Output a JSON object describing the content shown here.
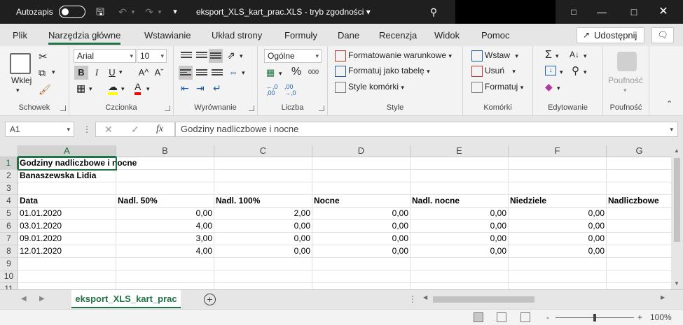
{
  "titlebar": {
    "autosave_label": "Autozapis",
    "autosave_state": "off",
    "doc_title": "eksport_XLS_kart_prac.XLS  -  tryb zgodności  ▾"
  },
  "tabs": [
    "Plik",
    "Narzędzia główne",
    "Wstawianie",
    "Układ strony",
    "Formuły",
    "Dane",
    "Recenzja",
    "Widok",
    "Pomoc"
  ],
  "active_tab": "Narzędzia główne",
  "share_label": "Udostępnij",
  "ribbon": {
    "clipboard": {
      "label": "Schowek",
      "paste": "Wklej"
    },
    "font": {
      "label": "Czcionka",
      "name": "Arial",
      "size": "10",
      "bold": "B",
      "italic": "I",
      "underline": "U",
      "grow": "A^",
      "shrink": "Aˇ"
    },
    "alignment": {
      "label": "Wyrównanie"
    },
    "number": {
      "label": "Liczba",
      "format": "Ogólne",
      "percent": "%",
      "thousands": "000"
    },
    "styles": {
      "label": "Style",
      "conditional": "Formatowanie warunkowe",
      "as_table": "Formatuj jako tabelę",
      "cell_styles": "Style komórki"
    },
    "cells": {
      "label": "Komórki",
      "insert": "Wstaw",
      "delete": "Usuń",
      "format": "Formatuj"
    },
    "editing": {
      "label": "Edytowanie"
    },
    "sensitivity": {
      "label": "Poufność",
      "button": "Poufność"
    }
  },
  "formula_bar": {
    "name_box": "A1",
    "fx": "fx",
    "content": "Godziny nadliczbowe i nocne"
  },
  "columns": [
    "A",
    "B",
    "C",
    "D",
    "E",
    "F",
    "G"
  ],
  "rows": [
    {
      "n": "1",
      "cells": [
        "Godziny nadliczbowe i nocne",
        "",
        "",
        "",
        "",
        "",
        ""
      ]
    },
    {
      "n": "2",
      "cells": [
        "Banaszewska Lidia",
        "",
        "",
        "",
        "",
        "",
        ""
      ]
    },
    {
      "n": "3",
      "cells": [
        "",
        "",
        "",
        "",
        "",
        "",
        ""
      ]
    },
    {
      "n": "4",
      "cells": [
        "Data",
        "Nadl. 50%",
        "Nadl. 100%",
        "Nocne",
        "Nadl. nocne",
        "Niedziele",
        "Nadliczbowe"
      ]
    },
    {
      "n": "5",
      "cells": [
        "01.01.2020",
        "0,00",
        "2,00",
        "0,00",
        "0,00",
        "0,00",
        ""
      ]
    },
    {
      "n": "6",
      "cells": [
        "03.01.2020",
        "4,00",
        "0,00",
        "0,00",
        "0,00",
        "0,00",
        ""
      ]
    },
    {
      "n": "7",
      "cells": [
        "09.01.2020",
        "3,00",
        "0,00",
        "0,00",
        "0,00",
        "0,00",
        ""
      ]
    },
    {
      "n": "8",
      "cells": [
        "12.01.2020",
        "4,00",
        "0,00",
        "0,00",
        "0,00",
        "0,00",
        ""
      ]
    },
    {
      "n": "9",
      "cells": [
        "",
        "",
        "",
        "",
        "",
        "",
        ""
      ]
    },
    {
      "n": "10",
      "cells": [
        "",
        "",
        "",
        "",
        "",
        "",
        ""
      ]
    },
    {
      "n": "11",
      "cells": [
        "",
        "",
        "",
        "",
        "",
        "",
        ""
      ]
    }
  ],
  "sheet_tab": "eksport_XLS_kart_prac",
  "status": {
    "zoom": "100%",
    "zoom_minus": "-",
    "zoom_plus": "+"
  },
  "colors": {
    "accent": "#217346",
    "titlebar": "#1f1f1f"
  }
}
